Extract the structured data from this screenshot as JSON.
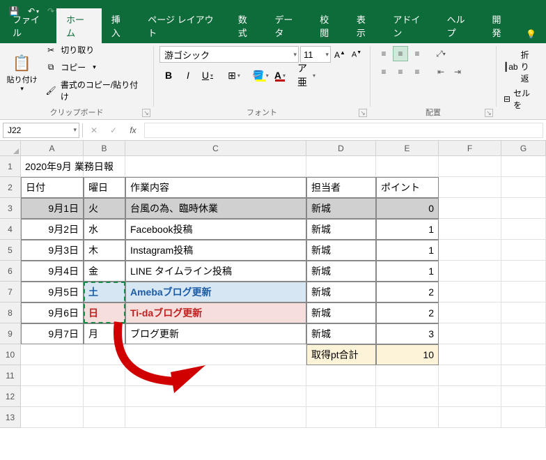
{
  "titlebar": {
    "save_icon": "💾",
    "undo_icon": "↶",
    "redo_icon": "↷",
    "customize_icon": "▾"
  },
  "ribbon_tabs": {
    "file": "ファイル",
    "home": "ホーム",
    "insert": "挿入",
    "page_layout": "ページ レイアウト",
    "formulas": "数式",
    "data": "データ",
    "review": "校閲",
    "view": "表示",
    "addins": "アドイン",
    "help": "ヘルプ",
    "developer": "開発"
  },
  "clipboard": {
    "paste": "貼り付け",
    "cut": "切り取り",
    "copy": "コピー",
    "format_painter": "書式のコピー/貼り付け",
    "group_label": "クリップボード"
  },
  "font": {
    "name": "游ゴシック",
    "size": "11",
    "bold": "B",
    "italic": "I",
    "underline": "U",
    "group_label": "フォント"
  },
  "alignment": {
    "group_label": "配置",
    "wrap": "折り返",
    "merge": "セルを"
  },
  "formula_bar": {
    "name_box": "J22",
    "fx": "fx"
  },
  "columns": [
    "A",
    "B",
    "C",
    "D",
    "E",
    "F",
    "G"
  ],
  "sheet": {
    "r1": {
      "A": "2020年9月 業務日報"
    },
    "r2": {
      "A": "日付",
      "B": "曜日",
      "C": "作業内容",
      "D": "担当者",
      "E": "ポイント"
    },
    "r3": {
      "A": "9月1日",
      "B": "火",
      "C": "台風の為、臨時休業",
      "D": "新城",
      "E": "0"
    },
    "r4": {
      "A": "9月2日",
      "B": "水",
      "C": "Facebook投稿",
      "D": "新城",
      "E": "1"
    },
    "r5": {
      "A": "9月3日",
      "B": "木",
      "C": "Instagram投稿",
      "D": "新城",
      "E": "1"
    },
    "r6": {
      "A": "9月4日",
      "B": "金",
      "C": "LINE タイムライン投稿",
      "D": "新城",
      "E": "1"
    },
    "r7": {
      "A": "9月5日",
      "B": "土",
      "C": "Amebaブログ更新",
      "D": "新城",
      "E": "2"
    },
    "r8": {
      "A": "9月6日",
      "B": "日",
      "C": "Ti-daブログ更新",
      "D": "新城",
      "E": "2"
    },
    "r9": {
      "A": "9月7日",
      "B": "月",
      "C": "ブログ更新",
      "D": "新城",
      "E": "3"
    },
    "r10": {
      "D": "取得pt合計",
      "E": "10"
    }
  }
}
